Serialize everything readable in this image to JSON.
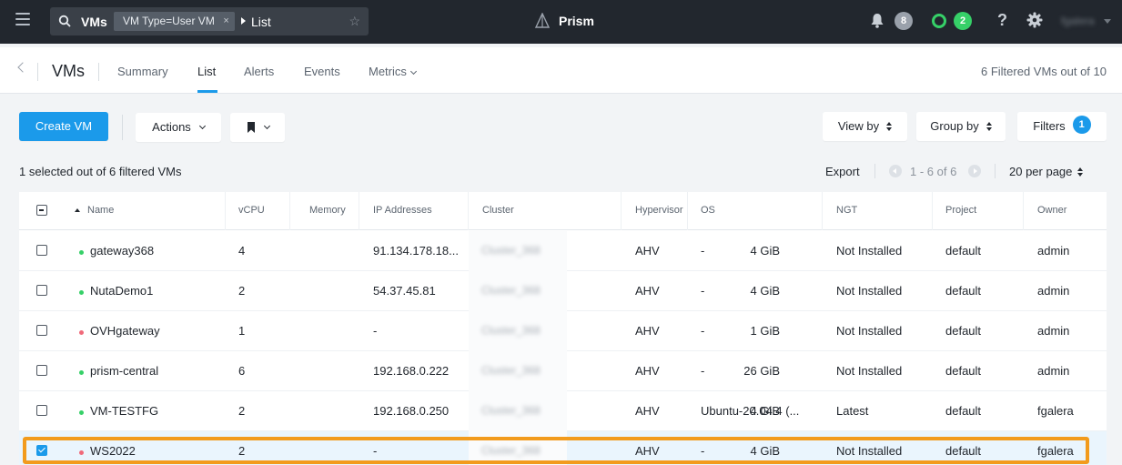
{
  "topbar": {
    "entity": "VMs",
    "filter_chip": "VM Type=User VM",
    "chip_close": "×",
    "crumb": "List",
    "app_name": "Prism",
    "alerts_count": "8",
    "health_count": "2",
    "help_glyph": "?",
    "user_name": "fgalera",
    "accent": "#1b9aea",
    "health_color": "#36d068"
  },
  "nav": {
    "title": "VMs",
    "tabs": [
      "Summary",
      "List",
      "Alerts",
      "Events",
      "Metrics"
    ],
    "active_tab": "List",
    "filtered_summary": "6 Filtered VMs out of 10"
  },
  "toolbar": {
    "create_label": "Create VM",
    "actions_label": "Actions",
    "view_by_label": "View by",
    "group_by_label": "Group by",
    "filters_label": "Filters",
    "filters_count": "1"
  },
  "selection": {
    "info": "1 selected out of 6 filtered VMs",
    "export_label": "Export",
    "range": "1 - 6 of 6",
    "per_page": "20 per page"
  },
  "table": {
    "headers": [
      "Name",
      "vCPU",
      "Memory",
      "IP Addresses",
      "Cluster",
      "Hypervisor",
      "OS",
      "NGT",
      "Project",
      "Owner"
    ],
    "rows": [
      {
        "name": "gateway368",
        "status": "on",
        "vcpu": "4",
        "memory": "4 GiB",
        "ip": "91.134.178.18...",
        "cluster": "Cluster_368",
        "hypervisor": "AHV",
        "os": "-",
        "ngt": "Not Installed",
        "project": "default",
        "owner": "admin",
        "selected": false
      },
      {
        "name": "NutaDemo1",
        "status": "on",
        "vcpu": "2",
        "memory": "4 GiB",
        "ip": "54.37.45.81",
        "cluster": "Cluster_368",
        "hypervisor": "AHV",
        "os": "-",
        "ngt": "Not Installed",
        "project": "default",
        "owner": "admin",
        "selected": false
      },
      {
        "name": "OVHgateway",
        "status": "off",
        "vcpu": "1",
        "memory": "1 GiB",
        "ip": "-",
        "cluster": "Cluster_368",
        "hypervisor": "AHV",
        "os": "-",
        "ngt": "Not Installed",
        "project": "default",
        "owner": "admin",
        "selected": false
      },
      {
        "name": "prism-central",
        "status": "on",
        "vcpu": "6",
        "memory": "26 GiB",
        "ip": "192.168.0.222",
        "cluster": "Cluster_368",
        "hypervisor": "AHV",
        "os": "-",
        "ngt": "Not Installed",
        "project": "default",
        "owner": "admin",
        "selected": false
      },
      {
        "name": "VM-TESTFG",
        "status": "on",
        "vcpu": "2",
        "memory": "4 GiB",
        "ip": "192.168.0.250",
        "cluster": "Cluster_368",
        "hypervisor": "AHV",
        "os": "Ubuntu-20.04.4 (...",
        "ngt": "Latest",
        "project": "default",
        "owner": "fgalera",
        "selected": false
      },
      {
        "name": "WS2022",
        "status": "off",
        "vcpu": "2",
        "memory": "4 GiB",
        "ip": "-",
        "cluster": "Cluster_368",
        "hypervisor": "AHV",
        "os": "-",
        "ngt": "Not Installed",
        "project": "default",
        "owner": "fgalera",
        "selected": true
      }
    ],
    "status_colors": {
      "on": "#36d068",
      "off": "#f06a7a"
    },
    "highlight_color": "#f29b1d"
  }
}
